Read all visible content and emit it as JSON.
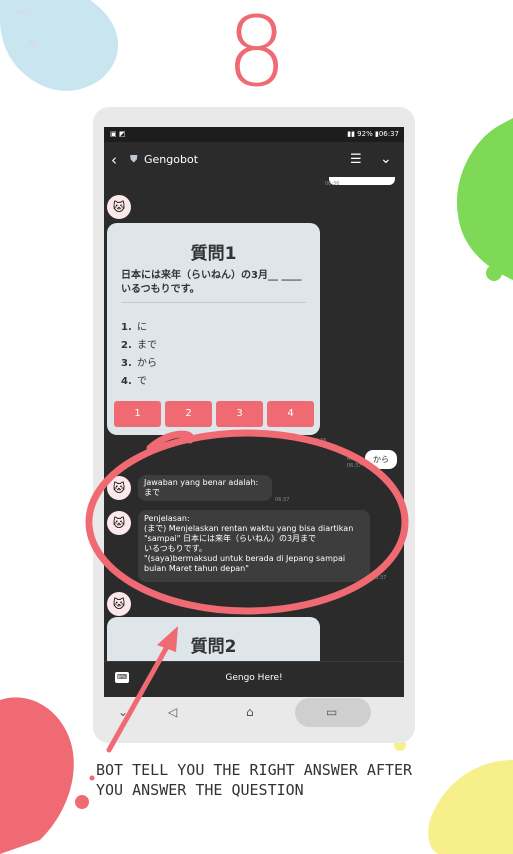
{
  "step": {
    "number": "8"
  },
  "statusbar": {
    "battery": "92%",
    "time": "06:37"
  },
  "header": {
    "title": "Gengobot"
  },
  "chat": {
    "earlier_time": "06:36",
    "question_card": {
      "title": "質問1",
      "text": "日本には来年（らいねん）の3月__ ____いるつもりです。",
      "options": [
        {
          "num": "1.",
          "text": "に"
        },
        {
          "num": "2.",
          "text": "まで"
        },
        {
          "num": "3.",
          "text": "から"
        },
        {
          "num": "4.",
          "text": "で"
        }
      ],
      "buttons": [
        "1",
        "2",
        "3",
        "4"
      ],
      "time": "06:36"
    },
    "user_reply": {
      "text": "から",
      "read": "Read",
      "time": "06:37"
    },
    "answer_msg": {
      "line1": "Jawaban yang benar adalah:",
      "line2": "まで",
      "time": "06:37"
    },
    "explanation_msg": {
      "line1": "Penjelasan:",
      "line2": "(まで) Menjelaskan rentan waktu yang bisa diartikan",
      "line3": "\"sampai\" 日本には来年（らいねん）の3月まで",
      "line4": "いるつもりです。",
      "line5": "\"(saya)bermaksud untuk berada di Jepang sampai",
      "line6": "bulan Maret tahun depan\"",
      "time": "06:37"
    },
    "next_card": {
      "title": "質問2"
    }
  },
  "input": {
    "placeholder": "Gengo Here!"
  },
  "caption": {
    "line1": "BOT TELL YOU THE RIGHT ANSWER AFTER",
    "line2": "YOU ANSWER THE QUESTION"
  },
  "colors": {
    "accent": "#f06a73",
    "card": "#dee6ea",
    "chat_bg": "#2b2b2b",
    "green": "#7ed957",
    "yellow": "#f7f08a",
    "blue": "#bfe3ee"
  }
}
